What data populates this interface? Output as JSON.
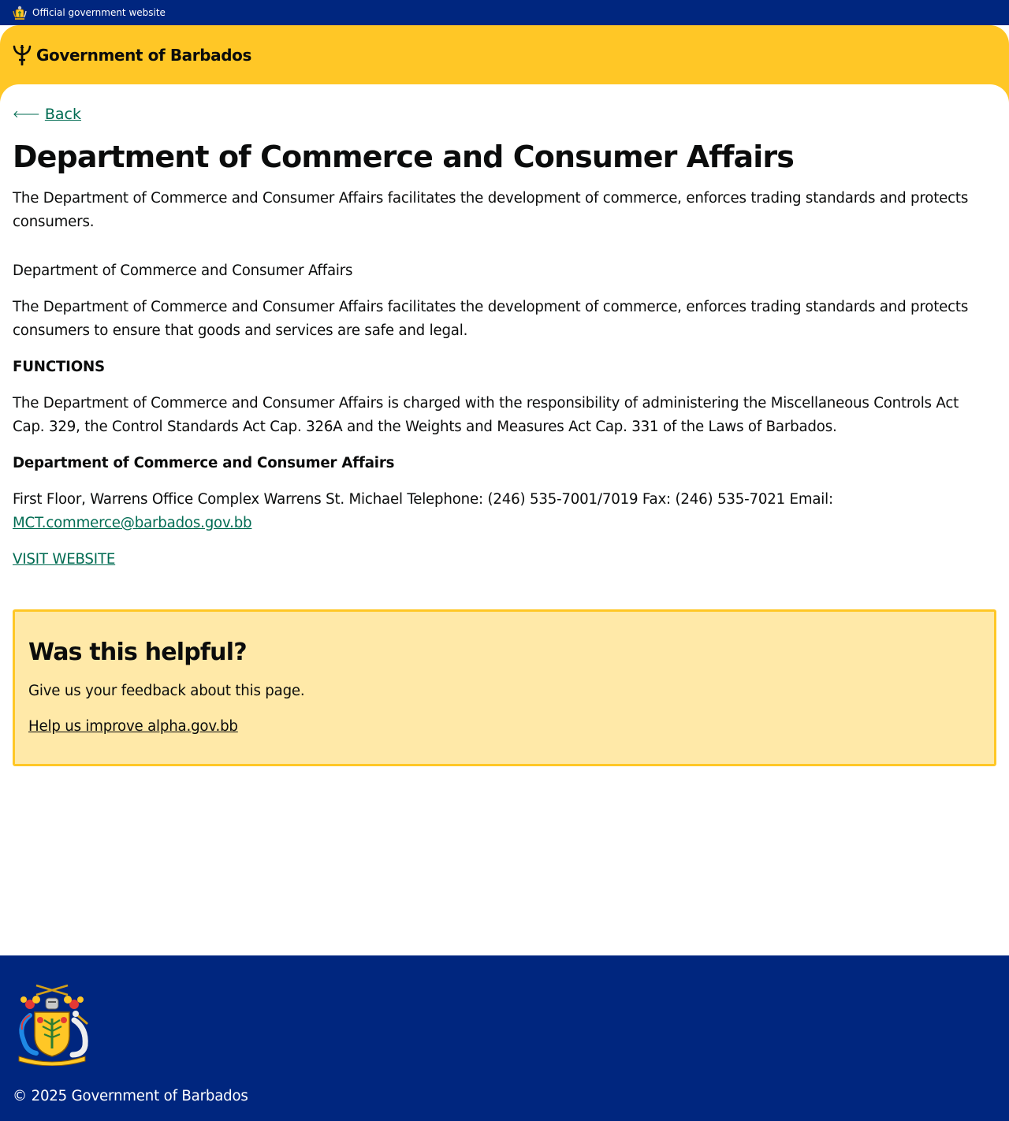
{
  "topbar": {
    "official_text": "Official government website",
    "crest_icon": "barbados-coat-of-arms-icon"
  },
  "header": {
    "brand_name": "Government of Barbados",
    "logo_icon": "trident-icon",
    "colors": {
      "banner": "#00267f",
      "header": "#ffc726"
    }
  },
  "nav": {
    "back_label": "Back",
    "back_icon": "arrow-left-icon"
  },
  "page": {
    "title": "Department of Commerce and Consumer Affairs",
    "summary": "The Department of Commerce and Consumer Affairs facilitates the development of commerce, enforces trading standards and protects consumers.",
    "section_name": "Department of Commerce and Consumer Affairs",
    "description": "The Department of Commerce and Consumer Affairs facilitates the development of commerce, enforces trading standards and protects consumers to ensure that goods and services are safe and legal.",
    "functions_heading": "FUNCTIONS",
    "functions_text": "The Department of Commerce and Consumer Affairs is charged with the responsibility of administering the Miscellaneous Controls Act Cap. 329, the Control Standards Act Cap. 326A and the Weights and Measures Act Cap. 331 of the Laws of Barbados.",
    "contact_heading": "Department of Commerce and Consumer Affairs",
    "contact_text": "First Floor, Warrens Office Complex Warrens St. Michael Telephone: (246) 535-7001/7019 Fax: (246) 535-7021 Email:",
    "contact_email": "MCT.commerce@barbados.gov.bb",
    "visit_website_label": "VISIT WEBSITE",
    "link_color": "#006b52"
  },
  "feedback": {
    "heading": "Was this helpful?",
    "text": "Give us your feedback about this page.",
    "link_label": "Help us improve alpha.gov.bb",
    "colors": {
      "background": "#ffe9a8",
      "border": "#ffc726"
    }
  },
  "footer": {
    "copyright": "© 2025 Government of Barbados",
    "crest_icon": "barbados-coat-of-arms-icon",
    "crest_motto": [
      "PRIDE",
      "AND",
      "INDUSTRY"
    ]
  }
}
